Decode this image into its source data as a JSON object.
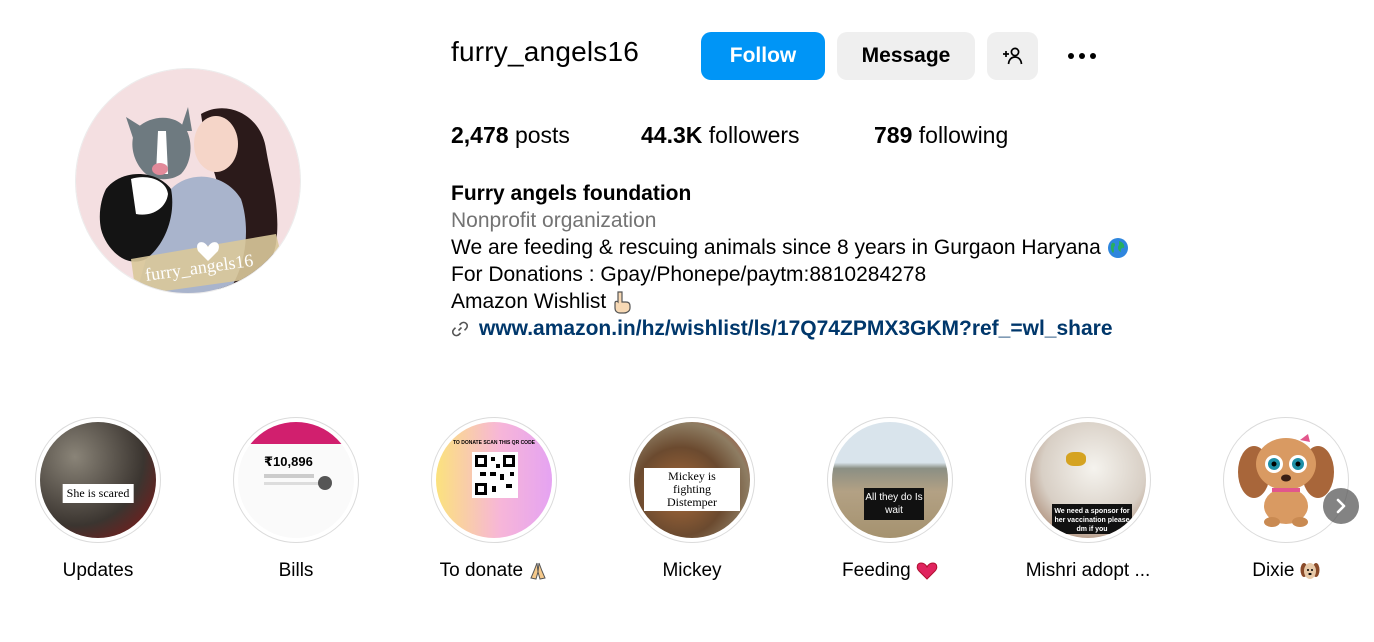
{
  "profile": {
    "username": "furry_angels16",
    "avatar_text": "furry_angels16"
  },
  "actions": {
    "follow_label": "Follow",
    "message_label": "Message",
    "suggest_icon": "person-add-icon",
    "more_icon": "more-options-icon"
  },
  "stats": {
    "posts_count": "2,478",
    "posts_label": "posts",
    "followers_count": "44.3K",
    "followers_label": "followers",
    "following_count": "789",
    "following_label": "following"
  },
  "bio": {
    "name": "Furry angels foundation",
    "category": "Nonprofit organization",
    "line1": "We are feeding & rescuing animals since 8 years in Gurgaon Haryana",
    "line2": "For Donations : Gpay/Phonepe/paytm:8810284278",
    "line3": "Amazon Wishlist",
    "link": "www.amazon.in/hz/wishlist/ls/17Q74ZPMX3GKM?ref_=wl_share"
  },
  "highlights": [
    {
      "label": "Updates",
      "caption": "She is scared"
    },
    {
      "label": "Bills",
      "caption": "₹10,896"
    },
    {
      "label": "To donate",
      "caption": "TO DONATE SCAN THIS QR CODE"
    },
    {
      "label": "Mickey",
      "caption": "Mickey is fighting Distemper"
    },
    {
      "label": "Feeding",
      "caption": "All they do Is wait"
    },
    {
      "label": "Mishri adopt ...",
      "caption": "We need a sponsor for her vaccination please dm if you"
    },
    {
      "label": "Dixie",
      "caption": ""
    }
  ],
  "colors": {
    "accent": "#0095f6",
    "link": "#00376b",
    "secondary_text": "#737373",
    "button_bg": "#efefef"
  }
}
